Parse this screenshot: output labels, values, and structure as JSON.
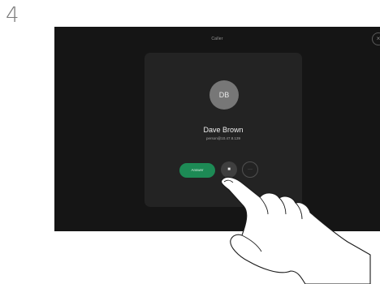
{
  "step": {
    "number": "4"
  },
  "call_screen": {
    "title": "Caller",
    "close_glyph": "×"
  },
  "incoming_call": {
    "avatar_initials": "DB",
    "caller_name": "Dave Brown",
    "caller_address": "person@10.47.8.139",
    "answer_label": "Answer",
    "video_glyph": "■",
    "decline_glyph": "···"
  },
  "colors": {
    "screen_background": "#151515",
    "card_background": "#232323",
    "answer_green": "#1d8a55",
    "avatar_grey": "#777777"
  },
  "icons": {
    "close": "close-icon",
    "video": "video-icon",
    "decline": "decline-icon",
    "pointer": "pointing-hand-icon"
  }
}
